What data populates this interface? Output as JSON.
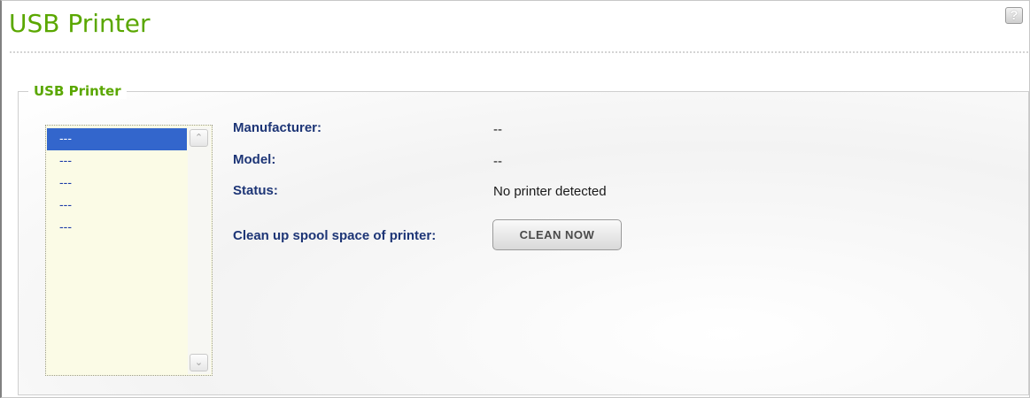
{
  "header": {
    "title": "USB Printer",
    "help_label": "?"
  },
  "group": {
    "legend": "USB Printer"
  },
  "printer_list": {
    "items": [
      "---",
      "---",
      "---",
      "---",
      "---"
    ],
    "selected_index": 0
  },
  "details": {
    "manufacturer_label": "Manufacturer:",
    "manufacturer_value": "--",
    "model_label": "Model:",
    "model_value": "--",
    "status_label": "Status:",
    "status_value": "No printer detected",
    "cleanup_label": "Clean up spool space of printer:",
    "clean_button_label": "CLEAN NOW"
  },
  "colors": {
    "accent_green": "#5aa700",
    "label_navy": "#1d3576",
    "selection_blue": "#3366cc",
    "list_background": "#fbfbe6"
  },
  "icons": {
    "help": "help-icon",
    "scroll_up": "chevron-up-icon",
    "scroll_down": "chevron-down-icon"
  }
}
